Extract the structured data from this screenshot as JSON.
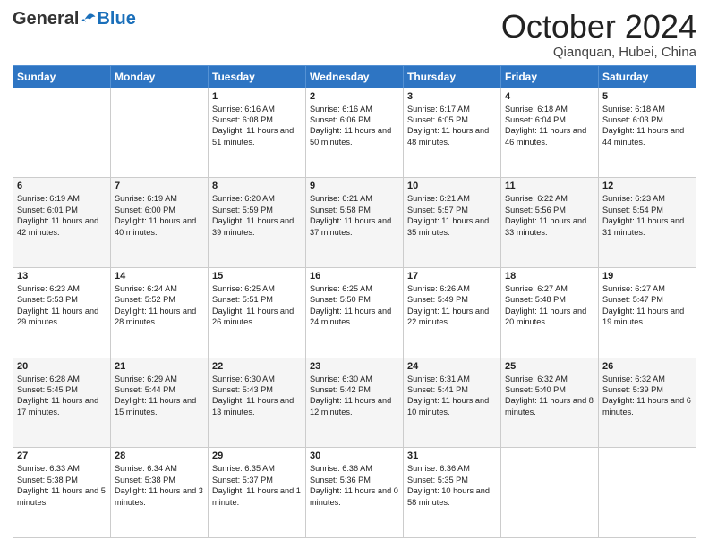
{
  "header": {
    "logo": {
      "general": "General",
      "blue": "Blue",
      "tagline": ""
    },
    "title": "October 2024",
    "subtitle": "Qianquan, Hubei, China"
  },
  "columns": [
    "Sunday",
    "Monday",
    "Tuesday",
    "Wednesday",
    "Thursday",
    "Friday",
    "Saturday"
  ],
  "rows": [
    [
      {
        "day": "",
        "text": ""
      },
      {
        "day": "",
        "text": ""
      },
      {
        "day": "1",
        "text": "Sunrise: 6:16 AM\nSunset: 6:08 PM\nDaylight: 11 hours and 51 minutes."
      },
      {
        "day": "2",
        "text": "Sunrise: 6:16 AM\nSunset: 6:06 PM\nDaylight: 11 hours and 50 minutes."
      },
      {
        "day": "3",
        "text": "Sunrise: 6:17 AM\nSunset: 6:05 PM\nDaylight: 11 hours and 48 minutes."
      },
      {
        "day": "4",
        "text": "Sunrise: 6:18 AM\nSunset: 6:04 PM\nDaylight: 11 hours and 46 minutes."
      },
      {
        "day": "5",
        "text": "Sunrise: 6:18 AM\nSunset: 6:03 PM\nDaylight: 11 hours and 44 minutes."
      }
    ],
    [
      {
        "day": "6",
        "text": "Sunrise: 6:19 AM\nSunset: 6:01 PM\nDaylight: 11 hours and 42 minutes."
      },
      {
        "day": "7",
        "text": "Sunrise: 6:19 AM\nSunset: 6:00 PM\nDaylight: 11 hours and 40 minutes."
      },
      {
        "day": "8",
        "text": "Sunrise: 6:20 AM\nSunset: 5:59 PM\nDaylight: 11 hours and 39 minutes."
      },
      {
        "day": "9",
        "text": "Sunrise: 6:21 AM\nSunset: 5:58 PM\nDaylight: 11 hours and 37 minutes."
      },
      {
        "day": "10",
        "text": "Sunrise: 6:21 AM\nSunset: 5:57 PM\nDaylight: 11 hours and 35 minutes."
      },
      {
        "day": "11",
        "text": "Sunrise: 6:22 AM\nSunset: 5:56 PM\nDaylight: 11 hours and 33 minutes."
      },
      {
        "day": "12",
        "text": "Sunrise: 6:23 AM\nSunset: 5:54 PM\nDaylight: 11 hours and 31 minutes."
      }
    ],
    [
      {
        "day": "13",
        "text": "Sunrise: 6:23 AM\nSunset: 5:53 PM\nDaylight: 11 hours and 29 minutes."
      },
      {
        "day": "14",
        "text": "Sunrise: 6:24 AM\nSunset: 5:52 PM\nDaylight: 11 hours and 28 minutes."
      },
      {
        "day": "15",
        "text": "Sunrise: 6:25 AM\nSunset: 5:51 PM\nDaylight: 11 hours and 26 minutes."
      },
      {
        "day": "16",
        "text": "Sunrise: 6:25 AM\nSunset: 5:50 PM\nDaylight: 11 hours and 24 minutes."
      },
      {
        "day": "17",
        "text": "Sunrise: 6:26 AM\nSunset: 5:49 PM\nDaylight: 11 hours and 22 minutes."
      },
      {
        "day": "18",
        "text": "Sunrise: 6:27 AM\nSunset: 5:48 PM\nDaylight: 11 hours and 20 minutes."
      },
      {
        "day": "19",
        "text": "Sunrise: 6:27 AM\nSunset: 5:47 PM\nDaylight: 11 hours and 19 minutes."
      }
    ],
    [
      {
        "day": "20",
        "text": "Sunrise: 6:28 AM\nSunset: 5:45 PM\nDaylight: 11 hours and 17 minutes."
      },
      {
        "day": "21",
        "text": "Sunrise: 6:29 AM\nSunset: 5:44 PM\nDaylight: 11 hours and 15 minutes."
      },
      {
        "day": "22",
        "text": "Sunrise: 6:30 AM\nSunset: 5:43 PM\nDaylight: 11 hours and 13 minutes."
      },
      {
        "day": "23",
        "text": "Sunrise: 6:30 AM\nSunset: 5:42 PM\nDaylight: 11 hours and 12 minutes."
      },
      {
        "day": "24",
        "text": "Sunrise: 6:31 AM\nSunset: 5:41 PM\nDaylight: 11 hours and 10 minutes."
      },
      {
        "day": "25",
        "text": "Sunrise: 6:32 AM\nSunset: 5:40 PM\nDaylight: 11 hours and 8 minutes."
      },
      {
        "day": "26",
        "text": "Sunrise: 6:32 AM\nSunset: 5:39 PM\nDaylight: 11 hours and 6 minutes."
      }
    ],
    [
      {
        "day": "27",
        "text": "Sunrise: 6:33 AM\nSunset: 5:38 PM\nDaylight: 11 hours and 5 minutes."
      },
      {
        "day": "28",
        "text": "Sunrise: 6:34 AM\nSunset: 5:38 PM\nDaylight: 11 hours and 3 minutes."
      },
      {
        "day": "29",
        "text": "Sunrise: 6:35 AM\nSunset: 5:37 PM\nDaylight: 11 hours and 1 minute."
      },
      {
        "day": "30",
        "text": "Sunrise: 6:36 AM\nSunset: 5:36 PM\nDaylight: 11 hours and 0 minutes."
      },
      {
        "day": "31",
        "text": "Sunrise: 6:36 AM\nSunset: 5:35 PM\nDaylight: 10 hours and 58 minutes."
      },
      {
        "day": "",
        "text": ""
      },
      {
        "day": "",
        "text": ""
      }
    ]
  ]
}
